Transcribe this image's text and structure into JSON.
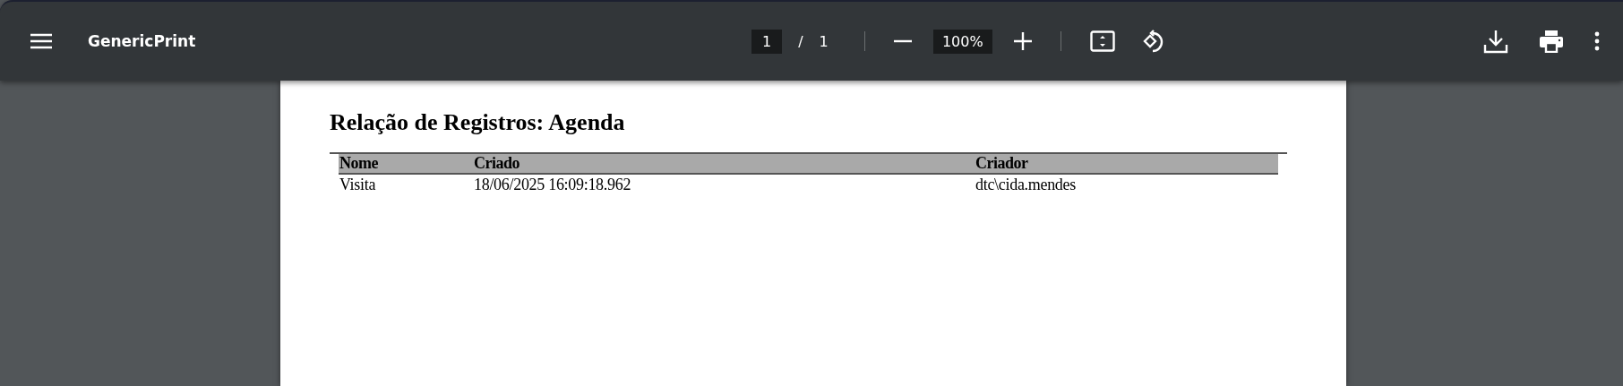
{
  "toolbar": {
    "title": "GenericPrint",
    "page_input": "1",
    "page_separator": "/",
    "page_total": "1",
    "zoom": "100%"
  },
  "document": {
    "title": "Relação de Registros: Agenda",
    "table": {
      "columns": [
        "Nome",
        "Criado",
        "Criador"
      ],
      "rows": [
        [
          "Visita",
          "18/06/2025 16:09:18.962",
          "dtc\\cida.mendes"
        ]
      ]
    }
  }
}
